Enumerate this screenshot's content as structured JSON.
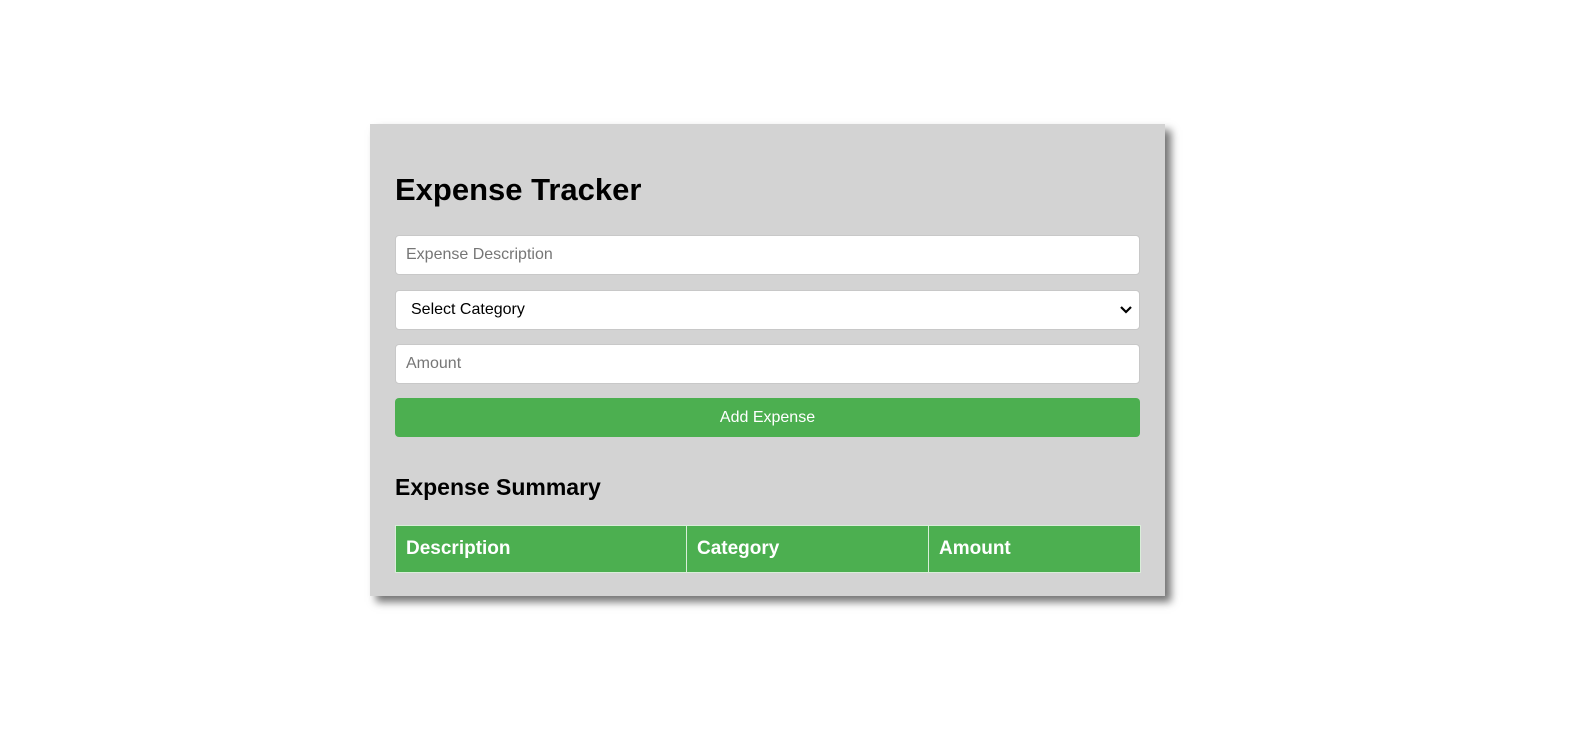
{
  "app": {
    "title": "Expense Tracker"
  },
  "form": {
    "description_placeholder": "Expense Description",
    "description_value": "",
    "category_selected": "Select Category",
    "amount_placeholder": "Amount",
    "amount_value": "",
    "add_button_label": "Add Expense"
  },
  "summary": {
    "title": "Expense Summary",
    "columns": [
      "Description",
      "Category",
      "Amount"
    ],
    "rows": []
  },
  "colors": {
    "accent": "#4caf50",
    "card_background": "#d3d3d3"
  }
}
